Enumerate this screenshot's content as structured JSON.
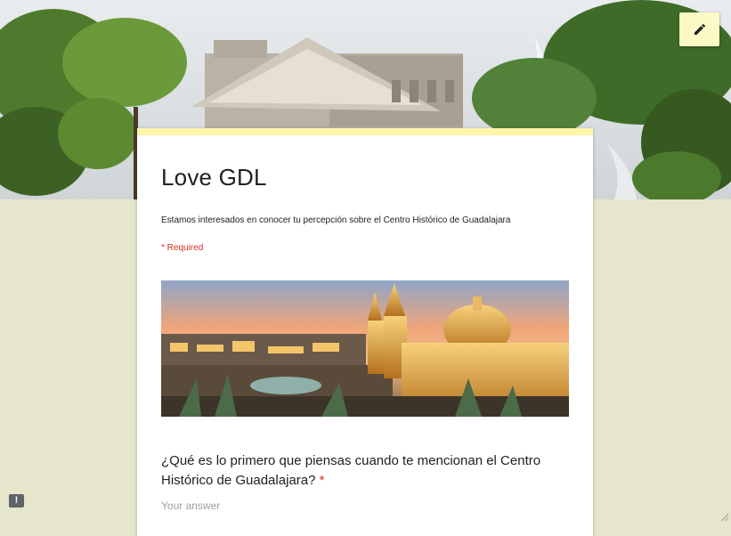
{
  "form": {
    "title": "Love GDL",
    "description": "Estamos interesados en conocer tu percepción sobre el Centro Histórico de Guadalajara",
    "required_note": "* Required"
  },
  "question": {
    "text": "¿Qué es lo primero que piensas cuando te mencionan el Centro Histórico de Guadalajara?",
    "required_mark": "*",
    "placeholder": "Your answer"
  },
  "icons": {
    "edit": "pencil-icon",
    "feedback": "feedback-icon",
    "feedback_glyph": "!"
  },
  "colors": {
    "page_background": "#e5e6cb",
    "card_accent": "#fdf5a8",
    "required": "#d93025"
  }
}
